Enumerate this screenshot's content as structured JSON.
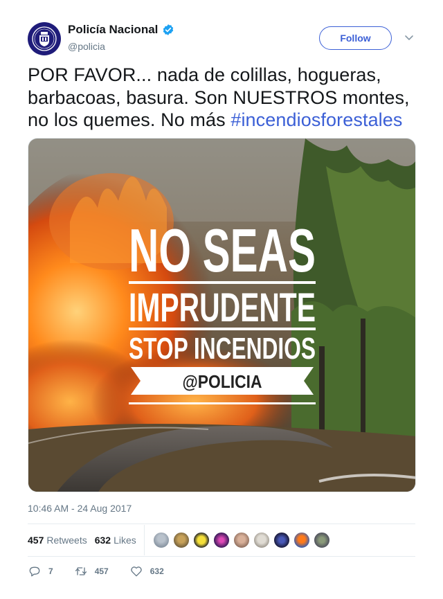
{
  "account": {
    "display_name": "Policía Nacional",
    "handle": "@policia",
    "follow_label": "Follow"
  },
  "tweet": {
    "text": "POR FAVOR... nada de colillas, hogueras, barbacoas, basura. Son NUESTROS montes, no los quemes. No más ",
    "hashtag": "#incendiosforestales"
  },
  "media": {
    "line1": "NO SEAS",
    "line2": "IMPRUDENTE",
    "line3": "STOP INCENDIOS",
    "banner": "@POLICIA"
  },
  "meta": {
    "timestamp": "10:46 AM - 24 Aug 2017"
  },
  "stats": {
    "retweets_count": "457",
    "retweets_label": "Retweets",
    "likes_count": "632",
    "likes_label": "Likes"
  },
  "actions": {
    "replies": "7",
    "retweets": "457",
    "likes": "632"
  },
  "colors": {
    "link": "#3b5fd6",
    "verified": "#1da1f2",
    "avatar_bg": "#1f1c7a"
  },
  "icons": [
    "verified-badge-icon",
    "chevron-down-icon",
    "reply-icon",
    "retweet-icon",
    "heart-icon"
  ]
}
